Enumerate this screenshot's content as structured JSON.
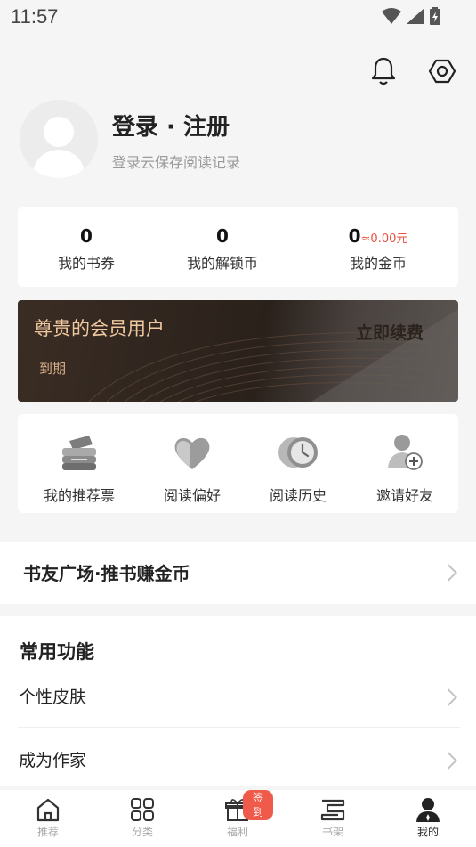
{
  "status_bar": {
    "time": "11:57"
  },
  "header": {
    "icons": [
      "bell-icon",
      "settings-hexagon-icon"
    ]
  },
  "profile": {
    "title": "登录 · 注册",
    "subtitle": "登录云保存阅读记录"
  },
  "stats": [
    {
      "value": "0",
      "label": "我的书券"
    },
    {
      "value": "0",
      "label": "我的解锁币"
    },
    {
      "value": "0",
      "extra": "≈0.00元",
      "label": "我的金币"
    }
  ],
  "vip": {
    "title": "尊贵的会员用户",
    "expire": "到期",
    "renew": "立即续费"
  },
  "quick": [
    {
      "label": "我的推荐票",
      "icon": "ticket-stack-icon"
    },
    {
      "label": "阅读偏好",
      "icon": "heart-icon"
    },
    {
      "label": "阅读历史",
      "icon": "clock-history-icon"
    },
    {
      "label": "邀请好友",
      "icon": "add-friend-icon"
    }
  ],
  "square": {
    "label": "书友广场·推书赚金币"
  },
  "functions": {
    "title": "常用功能",
    "items": [
      {
        "label": "个性皮肤"
      },
      {
        "label": "成为作家"
      }
    ]
  },
  "nav": {
    "items": [
      {
        "label": "推荐",
        "icon": "home-icon"
      },
      {
        "label": "分类",
        "icon": "grid-icon"
      },
      {
        "label": "福利",
        "icon": "gift-icon",
        "badge": "签到"
      },
      {
        "label": "书架",
        "icon": "bookshelf-icon"
      },
      {
        "label": "我的",
        "icon": "user-icon",
        "active": true
      }
    ]
  },
  "colors": {
    "accent": "#e8513c",
    "vip_gold": "#f0c9a0",
    "background": "#f5f5f5"
  }
}
